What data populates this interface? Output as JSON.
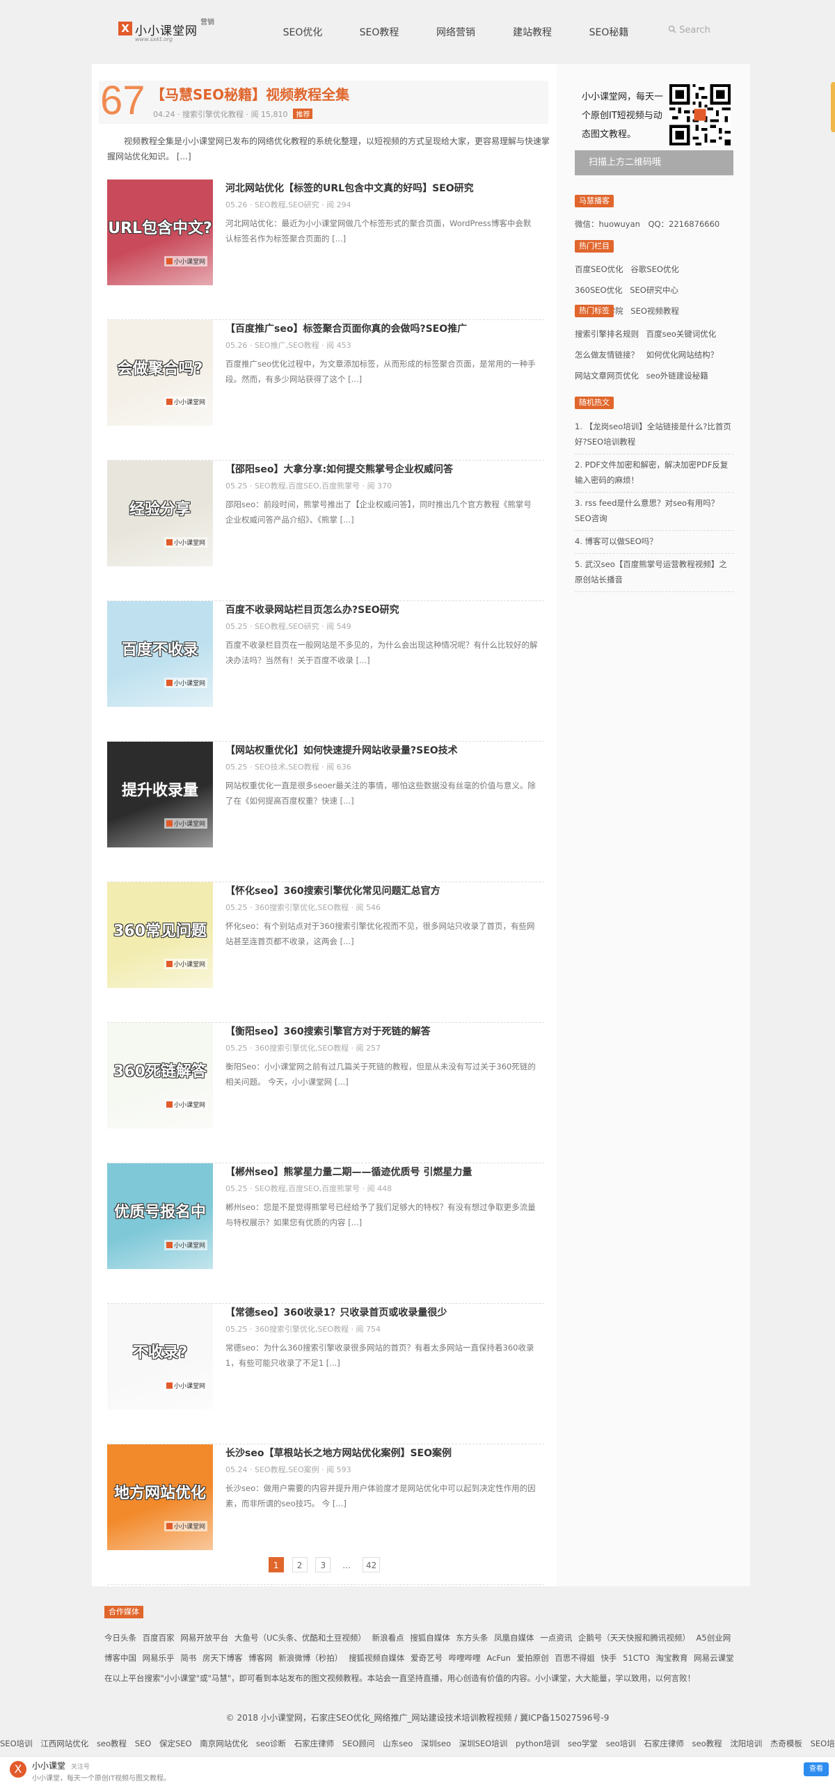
{
  "site": {
    "logo_mark": "X",
    "name": "小小课堂网",
    "logo_sub": "www.sxkt.org",
    "logo_tag": "营销"
  },
  "nav": [
    {
      "label": "SEO优化"
    },
    {
      "label": "SEO教程"
    },
    {
      "label": "网络营销"
    },
    {
      "label": "建站教程"
    },
    {
      "label": "SEO秘籍"
    }
  ],
  "search": {
    "placeholder": "Search"
  },
  "feature": {
    "count": "67",
    "title": "【马慧SEO秘籍】视频教程全集",
    "meta": "04.24 · 搜索引擎优化教程 · 阅 15,810",
    "hot": "推荐"
  },
  "intro": "视频教程全集是小小课堂网已发布的网络优化教程的系统化整理，以短视频的方式呈现给大家，更容易理解与快速掌握网站优化知识。 [...]",
  "posts": [
    {
      "title": "河北网站优化【标签的URL包含中文真的好吗】SEO研究",
      "meta": "05.26 · SEO教程,SEO研究 · 阅 294",
      "desc": "河北网站优化：最近为小小课堂网做几个标签形式的聚合页面，WordPress博客中会默认标签名作为标签聚合页面的 [...]",
      "thumb_text": "URL包含中文?",
      "thumb_color": "#c94a5a"
    },
    {
      "title": "【百度推广seo】标签聚合页面你真的会做吗?SEO推广",
      "meta": "05.26 · SEO推广,SEO教程 · 阅 453",
      "desc": "百度推广seo优化过程中，为文章添加标签，从而形成的标签聚合页面，是常用的一种手段。然而，有多少网站获得了这个 [...]",
      "thumb_text": "会做聚合吗?",
      "thumb_color": "#f4f0e8"
    },
    {
      "title": "【邵阳seo】大拿分享:如何提交熊掌号企业权威问答",
      "meta": "05.25 · SEO教程,百度SEO,百度熊掌号 · 阅 370",
      "desc": "邵阳seo：前段时间，熊掌号推出了【企业权威问答】，同时推出几个官方教程《熊掌号企业权威问答产品介绍》、《熊掌 [...]",
      "thumb_text": "经验分享",
      "thumb_color": "#e8e6dc"
    },
    {
      "title": "百度不收录网站栏目页怎么办?SEO研究",
      "meta": "05.25 · SEO教程,SEO研究 · 阅 549",
      "desc": "百度不收录栏目页在一般网站是不多见的，为什么会出现这种情况呢？有什么比较好的解决办法吗？当然有！关于百度不收录 [...]",
      "thumb_text": "百度不收录",
      "thumb_color": "#bfe1ef"
    },
    {
      "title": "【网站权重优化】如何快速提升网站收录量?SEO技术",
      "meta": "05.25 · SEO技术,SEO教程 · 阅 636",
      "desc": "网站权重优化一直是很多seoer最关注的事情，哪怕这些数据没有丝毫的价值与意义。除了在《如何提高百度权重？快速 [...]",
      "thumb_text": "提升收录量",
      "thumb_color": "#2c2c2c"
    },
    {
      "title": "【怀化seo】360搜索引擎优化常见问题汇总官方",
      "meta": "05.25 · 360搜索引擎优化,SEO教程 · 阅 546",
      "desc": "怀化seo：有个别站点对于360搜索引擎优化视而不见，很多网站只收录了首页，有些网站甚至连首页都不收录，这两会 [...]",
      "thumb_text": "360常见问题",
      "thumb_color": "#f2ecb0"
    },
    {
      "title": "【衡阳seo】360搜索引擎官方对于死链的解答",
      "meta": "05.25 · 360搜索引擎优化,SEO教程 · 阅 257",
      "desc": "衡阳Seo：小小课堂网之前有过几篇关于死链的教程，但是从未没有写过关于360死链的相关问题。 今天，小小课堂网 [...]",
      "thumb_text": "360死链解答",
      "thumb_color": "#f6f8f2"
    },
    {
      "title": "【郴州seo】熊掌星力量二期——循迹优质号 引燃星力量",
      "meta": "05.25 · SEO教程,百度SEO,百度熊掌号 · 阅 448",
      "desc": "郴州seo：您是不是觉得熊掌号已经给予了我们足够大的特权？有没有想过争取更多流量与特权展示？如果您有优质的内容 [...]",
      "thumb_text": "优质号报名中",
      "thumb_color": "#7fc8d8"
    },
    {
      "title": "【常德seo】360收录1？只收录首页或收录量很少",
      "meta": "05.25 · 360搜索引擎优化,SEO教程 · 阅 754",
      "desc": "常德seo：为什么360搜索引擎收录很多网站的首页？有着太多网站一直保持着360收录1，有些可能只收录了不足1 [...]",
      "thumb_text": "不收录?",
      "thumb_color": "#f8f8f8"
    },
    {
      "title": "长沙seo【草根站长之地方网站优化案例】SEO案例",
      "meta": "05.24 · SEO教程,SEO案例 · 阅 593",
      "desc": "长沙seo：做用户需要的内容并提升用户体验度才是网站优化中可以起到决定性作用的因素，而非所谓的seo技巧。 今 [...]",
      "thumb_text": "地方网站优化",
      "thumb_color": "#f28a2c"
    }
  ],
  "pager": {
    "current": "1",
    "p2": "2",
    "p3": "3",
    "dots": "…",
    "last": "42"
  },
  "qr": {
    "text": "小小课堂网，每天一个原创IT短视频与动态图文教程。",
    "button": "扫描上方二维码哦"
  },
  "sidebar": {
    "contact_title": "马慧播客",
    "contact_text": "微信：huowuyan　QQ：2216876660",
    "hot_col_title": "热门栏目",
    "hot_cols": [
      "百度SEO优化",
      "谷歌SEO优化",
      "360SEO优化",
      "SEO研究中心",
      "SEO培训学院",
      "SEO视频教程"
    ],
    "hot_tags_title": "热门标签",
    "hot_tags": [
      "搜索引擎排名规则",
      "百度seo关键词优化",
      "怎么做友情链接？",
      "如何优化网站结构？",
      "网站文章网页优化",
      "seo外链建设秘籍"
    ],
    "random_title": "随机热文",
    "random": [
      "1. 【龙岗seo培训】全站链接是什么?比首页好?SEO培训教程",
      "2. PDF文件加密和解密，解决加密PDF反复输入密码的麻烦！",
      "3. rss feed是什么意思？对seo有用吗？SEO咨询",
      "4. 博客可以做SEO吗？",
      "5. 武汉seo【百度熊掌号运营教程视频】之原创站长播音"
    ]
  },
  "coop": {
    "title": "合作媒体",
    "links": [
      "今日头条",
      "百度百家",
      "网易开放平台",
      "大鱼号（UC头条、优酷和土豆视频）",
      "新浪看点",
      "搜狐自媒体",
      "东方头条",
      "凤凰自媒体",
      "一点资讯",
      "企鹅号（天天快报和腾讯视频）",
      "A5创业网",
      "博客中国",
      "网易乐乎",
      "简书",
      "房天下博客",
      "博客网",
      "新浪微博（秒拍）",
      "搜狐视频自媒体",
      "爱奇艺号",
      "哔哩哔哩",
      "AcFun",
      "爱拍原创",
      "百思不得姐",
      "快手",
      "51CTO",
      "淘宝教育",
      "网易云课堂"
    ],
    "note": "在以上平台搜索\"小小课堂\"或\"马慧\"，即可看到本站发布的图文视频教程。本站会一直坚持直播，用心创造有价值的内容。小小课堂，大大能量，学以致用，以何言败！"
  },
  "copyright": "© 2018 小小课堂网，石家庄SEO优化_网络推广_网站建设技术培训教程视频 / 冀ICP备15027596号-9",
  "tags": [
    "SEO培训",
    "江西网站优化",
    "seo教程",
    "SEO",
    "保定SEO",
    "南京网站优化",
    "seo诊断",
    "石家庄律师",
    "SEO顾问",
    "山东seo",
    "深圳seo",
    "深圳SEO培训",
    "python培训",
    "seo学堂",
    "seo培训",
    "石家庄律师",
    "seo教程",
    "沈阳培训",
    "杰奇模板",
    "SEO培训"
  ],
  "bottombar": {
    "mark": "X",
    "name": "小小课堂",
    "small": "关注号",
    "desc": "小小课堂，每天一个原创IT视频与图文教程。",
    "button": "查看"
  }
}
